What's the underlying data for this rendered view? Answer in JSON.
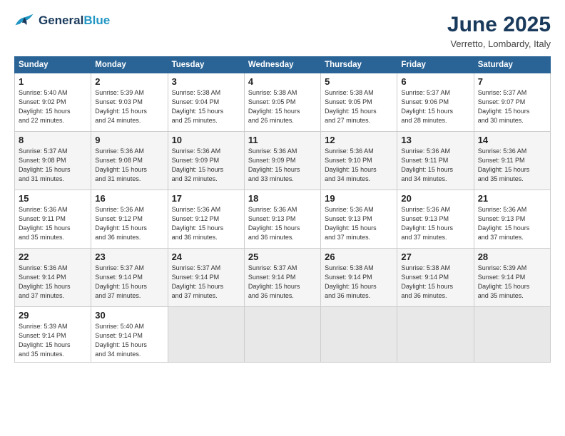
{
  "logo": {
    "line1": "General",
    "line2": "Blue"
  },
  "title": "June 2025",
  "subtitle": "Verretto, Lombardy, Italy",
  "weekdays": [
    "Sunday",
    "Monday",
    "Tuesday",
    "Wednesday",
    "Thursday",
    "Friday",
    "Saturday"
  ],
  "weeks": [
    [
      {
        "day": "1",
        "info": "Sunrise: 5:40 AM\nSunset: 9:02 PM\nDaylight: 15 hours\nand 22 minutes."
      },
      {
        "day": "2",
        "info": "Sunrise: 5:39 AM\nSunset: 9:03 PM\nDaylight: 15 hours\nand 24 minutes."
      },
      {
        "day": "3",
        "info": "Sunrise: 5:38 AM\nSunset: 9:04 PM\nDaylight: 15 hours\nand 25 minutes."
      },
      {
        "day": "4",
        "info": "Sunrise: 5:38 AM\nSunset: 9:05 PM\nDaylight: 15 hours\nand 26 minutes."
      },
      {
        "day": "5",
        "info": "Sunrise: 5:38 AM\nSunset: 9:05 PM\nDaylight: 15 hours\nand 27 minutes."
      },
      {
        "day": "6",
        "info": "Sunrise: 5:37 AM\nSunset: 9:06 PM\nDaylight: 15 hours\nand 28 minutes."
      },
      {
        "day": "7",
        "info": "Sunrise: 5:37 AM\nSunset: 9:07 PM\nDaylight: 15 hours\nand 30 minutes."
      }
    ],
    [
      {
        "day": "8",
        "info": "Sunrise: 5:37 AM\nSunset: 9:08 PM\nDaylight: 15 hours\nand 31 minutes."
      },
      {
        "day": "9",
        "info": "Sunrise: 5:36 AM\nSunset: 9:08 PM\nDaylight: 15 hours\nand 31 minutes."
      },
      {
        "day": "10",
        "info": "Sunrise: 5:36 AM\nSunset: 9:09 PM\nDaylight: 15 hours\nand 32 minutes."
      },
      {
        "day": "11",
        "info": "Sunrise: 5:36 AM\nSunset: 9:09 PM\nDaylight: 15 hours\nand 33 minutes."
      },
      {
        "day": "12",
        "info": "Sunrise: 5:36 AM\nSunset: 9:10 PM\nDaylight: 15 hours\nand 34 minutes."
      },
      {
        "day": "13",
        "info": "Sunrise: 5:36 AM\nSunset: 9:11 PM\nDaylight: 15 hours\nand 34 minutes."
      },
      {
        "day": "14",
        "info": "Sunrise: 5:36 AM\nSunset: 9:11 PM\nDaylight: 15 hours\nand 35 minutes."
      }
    ],
    [
      {
        "day": "15",
        "info": "Sunrise: 5:36 AM\nSunset: 9:11 PM\nDaylight: 15 hours\nand 35 minutes."
      },
      {
        "day": "16",
        "info": "Sunrise: 5:36 AM\nSunset: 9:12 PM\nDaylight: 15 hours\nand 36 minutes."
      },
      {
        "day": "17",
        "info": "Sunrise: 5:36 AM\nSunset: 9:12 PM\nDaylight: 15 hours\nand 36 minutes."
      },
      {
        "day": "18",
        "info": "Sunrise: 5:36 AM\nSunset: 9:13 PM\nDaylight: 15 hours\nand 36 minutes."
      },
      {
        "day": "19",
        "info": "Sunrise: 5:36 AM\nSunset: 9:13 PM\nDaylight: 15 hours\nand 37 minutes."
      },
      {
        "day": "20",
        "info": "Sunrise: 5:36 AM\nSunset: 9:13 PM\nDaylight: 15 hours\nand 37 minutes."
      },
      {
        "day": "21",
        "info": "Sunrise: 5:36 AM\nSunset: 9:13 PM\nDaylight: 15 hours\nand 37 minutes."
      }
    ],
    [
      {
        "day": "22",
        "info": "Sunrise: 5:36 AM\nSunset: 9:14 PM\nDaylight: 15 hours\nand 37 minutes."
      },
      {
        "day": "23",
        "info": "Sunrise: 5:37 AM\nSunset: 9:14 PM\nDaylight: 15 hours\nand 37 minutes."
      },
      {
        "day": "24",
        "info": "Sunrise: 5:37 AM\nSunset: 9:14 PM\nDaylight: 15 hours\nand 37 minutes."
      },
      {
        "day": "25",
        "info": "Sunrise: 5:37 AM\nSunset: 9:14 PM\nDaylight: 15 hours\nand 36 minutes."
      },
      {
        "day": "26",
        "info": "Sunrise: 5:38 AM\nSunset: 9:14 PM\nDaylight: 15 hours\nand 36 minutes."
      },
      {
        "day": "27",
        "info": "Sunrise: 5:38 AM\nSunset: 9:14 PM\nDaylight: 15 hours\nand 36 minutes."
      },
      {
        "day": "28",
        "info": "Sunrise: 5:39 AM\nSunset: 9:14 PM\nDaylight: 15 hours\nand 35 minutes."
      }
    ],
    [
      {
        "day": "29",
        "info": "Sunrise: 5:39 AM\nSunset: 9:14 PM\nDaylight: 15 hours\nand 35 minutes."
      },
      {
        "day": "30",
        "info": "Sunrise: 5:40 AM\nSunset: 9:14 PM\nDaylight: 15 hours\nand 34 minutes."
      },
      {
        "day": "",
        "info": ""
      },
      {
        "day": "",
        "info": ""
      },
      {
        "day": "",
        "info": ""
      },
      {
        "day": "",
        "info": ""
      },
      {
        "day": "",
        "info": ""
      }
    ]
  ]
}
